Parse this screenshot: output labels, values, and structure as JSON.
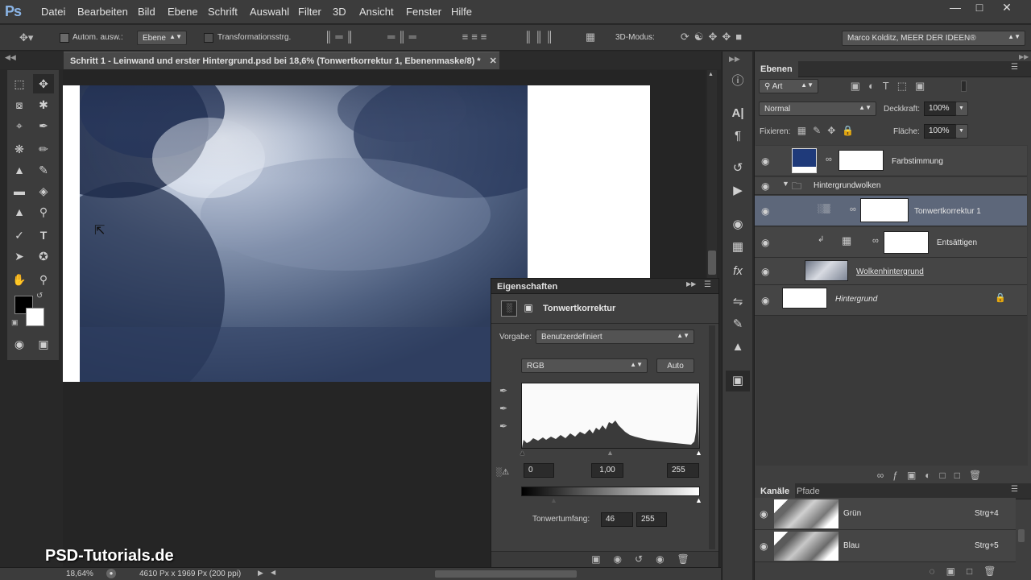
{
  "app": {
    "logo": "Ps"
  },
  "menu": [
    "Datei",
    "Bearbeiten",
    "Bild",
    "Ebene",
    "Schrift",
    "Auswahl",
    "Filter",
    "3D",
    "Ansicht",
    "Fenster",
    "Hilfe"
  ],
  "options": {
    "auto_select_label": "Autom. ausw.:",
    "auto_select_value": "Ebene",
    "transform_label": "Transformationsstrg.",
    "mode3d_label": "3D-Modus:",
    "workspace": "Marco Kolditz, MEER DER IDEEN®"
  },
  "document": {
    "tab_title": "Schritt 1 - Leinwand und erster Hintergrund.psd bei 18,6% (Tonwertkorrektur 1, Ebenenmaske/8) *"
  },
  "status": {
    "zoom": "18,64%",
    "doc_size": "4610 Px x 1969 Px (200 ppi)"
  },
  "brand": "PSD-Tutorials.de",
  "layers": {
    "tab": "Ebenen",
    "filter": "Art",
    "blend_mode": "Normal",
    "opacity_label": "Deckkraft:",
    "opacity": "100%",
    "lock_label": "Fixieren:",
    "fill_label": "Fläche:",
    "fill": "100%",
    "items": [
      {
        "name": "Farbstimmung"
      },
      {
        "name": "Hintergrundwolken"
      },
      {
        "name": "Tonwertkorrektur 1"
      },
      {
        "name": "Entsättigen"
      },
      {
        "name": "Wolkenhintergrund"
      },
      {
        "name": "Hintergrund"
      }
    ]
  },
  "channels": {
    "tabs": [
      "Kanäle",
      "Pfade"
    ],
    "items": [
      {
        "name": "Grün",
        "shortcut": "Strg+4"
      },
      {
        "name": "Blau",
        "shortcut": "Strg+5"
      }
    ]
  },
  "properties": {
    "title": "Eigenschaften",
    "adjustment": "Tonwertkorrektur",
    "preset_label": "Vorgabe:",
    "preset": "Benutzerdefiniert",
    "channel": "RGB",
    "auto": "Auto",
    "input_black": "0",
    "input_gamma": "1,00",
    "input_white": "255",
    "output_label": "Tonwertumfang:",
    "output_black": "46",
    "output_white": "255"
  },
  "colors": {
    "accent_selected_row": "#5d677a",
    "color_fill_swatch": "#1f3a7a",
    "panel_bg": "#3f3f3f"
  }
}
